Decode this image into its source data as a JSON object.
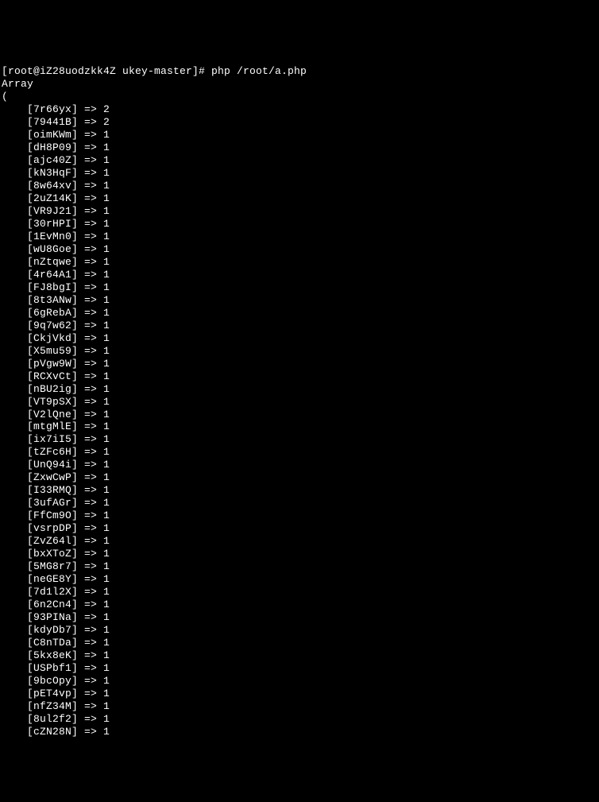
{
  "prompt": "[root@iZ28uodzkk4Z ukey-master]# php /root/a.php",
  "header1": "Array",
  "header2": "(",
  "indent": "    ",
  "entries": [
    {
      "key": "7r66yx",
      "value": "2"
    },
    {
      "key": "79441B",
      "value": "2"
    },
    {
      "key": "oimKWm",
      "value": "1"
    },
    {
      "key": "dH8P09",
      "value": "1"
    },
    {
      "key": "ajc40Z",
      "value": "1"
    },
    {
      "key": "kN3HqF",
      "value": "1"
    },
    {
      "key": "8w64xv",
      "value": "1"
    },
    {
      "key": "2uZ14K",
      "value": "1"
    },
    {
      "key": "VR9J21",
      "value": "1"
    },
    {
      "key": "30rHPI",
      "value": "1"
    },
    {
      "key": "1EvMn0",
      "value": "1"
    },
    {
      "key": "wU8Goe",
      "value": "1"
    },
    {
      "key": "nZtqwe",
      "value": "1"
    },
    {
      "key": "4r64A1",
      "value": "1"
    },
    {
      "key": "FJ8bgI",
      "value": "1"
    },
    {
      "key": "8t3ANw",
      "value": "1"
    },
    {
      "key": "6gRebA",
      "value": "1"
    },
    {
      "key": "9q7w62",
      "value": "1"
    },
    {
      "key": "CkjVkd",
      "value": "1"
    },
    {
      "key": "X5mu59",
      "value": "1"
    },
    {
      "key": "pVgw9W",
      "value": "1"
    },
    {
      "key": "RCXvCt",
      "value": "1"
    },
    {
      "key": "nBU2ig",
      "value": "1"
    },
    {
      "key": "VT9pSX",
      "value": "1"
    },
    {
      "key": "V2lQne",
      "value": "1"
    },
    {
      "key": "mtgMlE",
      "value": "1"
    },
    {
      "key": "ix7iI5",
      "value": "1"
    },
    {
      "key": "tZFc6H",
      "value": "1"
    },
    {
      "key": "UnQ94i",
      "value": "1"
    },
    {
      "key": "ZxwCwP",
      "value": "1"
    },
    {
      "key": "I33RMQ",
      "value": "1"
    },
    {
      "key": "3ufAGr",
      "value": "1"
    },
    {
      "key": "FfCm9O",
      "value": "1"
    },
    {
      "key": "vsrpDP",
      "value": "1"
    },
    {
      "key": "ZvZ64l",
      "value": "1"
    },
    {
      "key": "bxXToZ",
      "value": "1"
    },
    {
      "key": "5MG8r7",
      "value": "1"
    },
    {
      "key": "neGE8Y",
      "value": "1"
    },
    {
      "key": "7d1l2X",
      "value": "1"
    },
    {
      "key": "6n2Cn4",
      "value": "1"
    },
    {
      "key": "93PINa",
      "value": "1"
    },
    {
      "key": "kdyDb7",
      "value": "1"
    },
    {
      "key": "C8nTDa",
      "value": "1"
    },
    {
      "key": "5kx8eK",
      "value": "1"
    },
    {
      "key": "USPbf1",
      "value": "1"
    },
    {
      "key": "9bcOpy",
      "value": "1"
    },
    {
      "key": "pET4vp",
      "value": "1"
    },
    {
      "key": "nfZ34M",
      "value": "1"
    },
    {
      "key": "8ul2f2",
      "value": "1"
    },
    {
      "key": "cZN28N",
      "value": "1"
    }
  ]
}
